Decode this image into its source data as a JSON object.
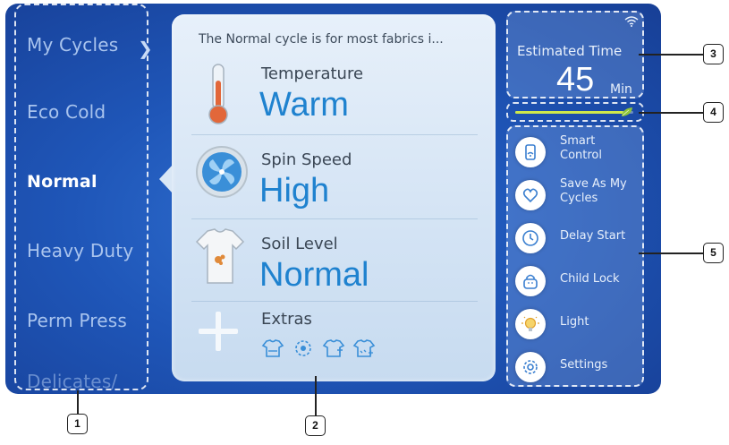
{
  "cycles": {
    "items": [
      {
        "label": "My Cycles"
      },
      {
        "label": "Eco Cold"
      },
      {
        "label": "Normal"
      },
      {
        "label": "Heavy Duty"
      },
      {
        "label": "Perm Press"
      },
      {
        "label": "Delicates/"
      }
    ],
    "selected": "Normal"
  },
  "center": {
    "description": "The Normal cycle is for most fabrics i...",
    "temperature": {
      "label": "Temperature",
      "value": "Warm"
    },
    "spin": {
      "label": "Spin Speed",
      "value": "High"
    },
    "soil": {
      "label": "Soil Level",
      "value": "Normal"
    },
    "extras": {
      "label": "Extras"
    }
  },
  "estimated": {
    "title": "Estimated Time",
    "value": "45",
    "unit": "Min"
  },
  "eco_level": 0.92,
  "controls": [
    {
      "label": "Smart Control",
      "icon": "smart-control-icon"
    },
    {
      "label": "Save As My Cycles",
      "icon": "save-cycle-icon"
    },
    {
      "label": "Delay Start",
      "icon": "clock-icon"
    },
    {
      "label": "Child Lock",
      "icon": "lock-icon"
    },
    {
      "label": "Light",
      "icon": "bulb-icon"
    },
    {
      "label": "Settings",
      "icon": "gear-icon"
    }
  ],
  "callouts": [
    "1",
    "2",
    "3",
    "4",
    "5"
  ],
  "colors": {
    "accent": "#1f82cf",
    "screen": "#1f56b8",
    "panel": "#dbe8f6"
  }
}
